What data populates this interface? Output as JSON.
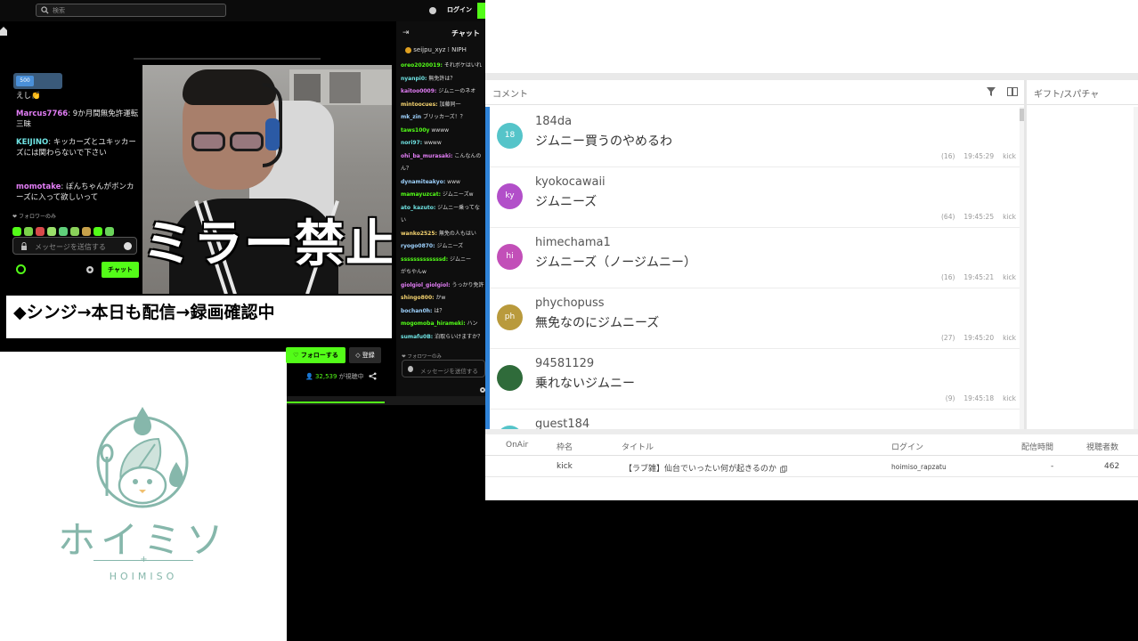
{
  "stream": {
    "search_placeholder": "検索",
    "login_label": "ログイン",
    "video_chat": [
      {
        "user": "",
        "text": "えし👏"
      },
      {
        "user": "Marcus7766",
        "text": "9か月間無免許運転三昧"
      },
      {
        "user": "KEIJINO",
        "text": "キッカーズとユキッカーズには関わらないで下さい"
      },
      {
        "user": "momotake",
        "text": "ぽんちゃんがボンカーズに入って欲しいって"
      }
    ],
    "followers_label": "フォロワーのみ",
    "message_placeholder": "メッセージを送信する",
    "chat_button": "チャット",
    "overlay_text": "ミラー禁止",
    "ticker_text": "◆シンジ→本日も配信→録画確認中",
    "follow_button": "♡ フォローする",
    "subscribe_button": "◇ 登録",
    "viewer_count": "32,539",
    "viewer_suffix": " が視聴中"
  },
  "kick_chat": {
    "collapse_icon": "⇥",
    "title": "チャット",
    "pinned": "seijpu_xyz  ⁞  NIPH",
    "lines": [
      {
        "user": "oreo2020019:",
        "text": "それボケはいれ"
      },
      {
        "user": "nyanpi0:",
        "text": "無免許は？"
      },
      {
        "user": "kaitoo0009:",
        "text": "ジムニーのネオ"
      },
      {
        "user": "mintoocues:",
        "text": "加藤同一"
      },
      {
        "user": "mk_zin",
        "text": "ブリッカーズ！？"
      },
      {
        "user": "taws100y",
        "text": "wwww"
      },
      {
        "user": "nori97:",
        "text": "wwww"
      },
      {
        "user": "ohi_ba_murasaki:",
        "text": "こんなんの"
      },
      {
        "user": "",
        "text": "ん？"
      },
      {
        "user": "dynamiteakyo:",
        "text": "www"
      },
      {
        "user": "mamayuzcat:",
        "text": "ジムニーズw"
      },
      {
        "user": "ato_kazuto:",
        "text": "ジムニー乗ってな"
      },
      {
        "user": "",
        "text": "い"
      },
      {
        "user": "wanko2525:",
        "text": "無免の人もはい"
      },
      {
        "user": "ryogo0870:",
        "text": "ジムニーズ"
      },
      {
        "user": "sssssssssssssd:",
        "text": "ジムニー"
      },
      {
        "user": "",
        "text": "がちやんw"
      },
      {
        "user": "giolgiol_giolgiol:",
        "text": "うっかり免許"
      },
      {
        "user": "shingo800:",
        "text": "かw"
      },
      {
        "user": "bochan0h:",
        "text": "は？"
      },
      {
        "user": "mogomoba_hirameki:",
        "text": "ハン"
      },
      {
        "user": "sumafu0B:",
        "text": "泊取らいけますか？"
      }
    ],
    "followers_label": "フォロワーのみ",
    "message_placeholder": "メッセージを送信する"
  },
  "logo": {
    "text": "ホイミソ",
    "sub": "HOIMISO",
    "color": "#86b7ab"
  },
  "viewer": {
    "comments_header": "コメント",
    "gifts_header": "ギフト/スパチャ",
    "comments": [
      {
        "avatar": "18",
        "avatar_color": "#55c4c9",
        "user": "184da",
        "text": "ジムニー買うのやめるわ",
        "count": "(16)",
        "time": "19:45:29",
        "platform": "kick"
      },
      {
        "avatar": "ky",
        "avatar_color": "#b24fc9",
        "user": "kyokocawaii",
        "text": "ジムニーズ",
        "count": "(64)",
        "time": "19:45:25",
        "platform": "kick"
      },
      {
        "avatar": "hi",
        "avatar_color": "#c24fb8",
        "user": "himechama1",
        "text": "ジムニーズ（ノージムニー）",
        "count": "(16)",
        "time": "19:45:21",
        "platform": "kick"
      },
      {
        "avatar": "ph",
        "avatar_color": "#b99a3c",
        "user": "phychopuss",
        "text": "無免なのにジムニーズ",
        "count": "(27)",
        "time": "19:45:20",
        "platform": "kick"
      },
      {
        "avatar": "",
        "avatar_color": "#2f6b3a",
        "user": "94581129",
        "text": "乗れないジムニー",
        "count": "(9)",
        "time": "19:45:18",
        "platform": "kick"
      },
      {
        "avatar": "",
        "avatar_color": "#55c4c9",
        "user": "guest184",
        "text": "",
        "count": "",
        "time": "",
        "platform": ""
      }
    ],
    "table": {
      "headers": [
        "OnAir",
        "枠名",
        "タイトル",
        "ログイン",
        "配信時間",
        "視聴者数"
      ],
      "row": {
        "onair": "",
        "frame": "kick",
        "title": "【ラブ雑】仙台でいったい何が起きるのか",
        "login": "hoimiso_rapzatu",
        "duration": "-",
        "viewers": "462"
      }
    }
  }
}
